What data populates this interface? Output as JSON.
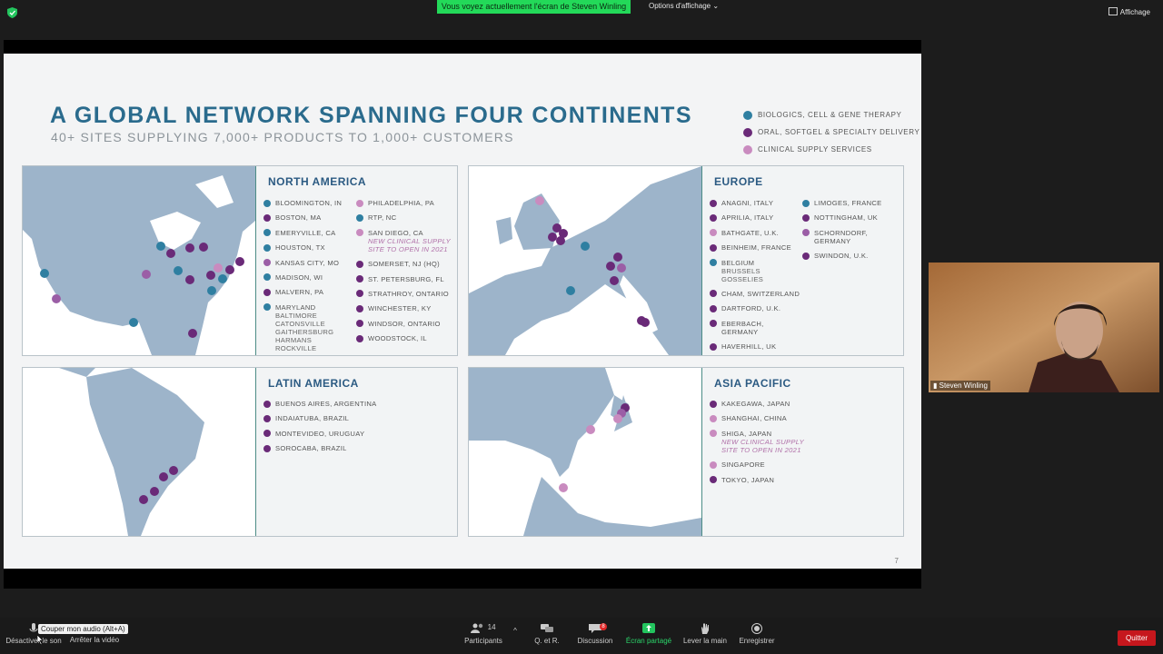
{
  "topbar": {
    "share_banner": "Vous voyez actuellement l'écran de Steven Winling",
    "view_options": "Options d'affichage ⌄",
    "view_label": "Affichage"
  },
  "slide": {
    "title": "A GLOBAL NETWORK SPANNING FOUR CONTINENTS",
    "subtitle": "40+ SITES SUPPLYING 7,000+ PRODUCTS TO 1,000+ CUSTOMERS",
    "legend": [
      {
        "label": "BIOLOGICS, CELL & GENE THERAPY",
        "color": "#2f7fa1"
      },
      {
        "label": "ORAL, SOFTGEL & SPECIALTY DELIVERY",
        "color": "#6a2a78"
      },
      {
        "label": "CLINICAL SUPPLY SERVICES",
        "color": "#c98bbf"
      }
    ],
    "page_number": "7",
    "regions": {
      "north_america": {
        "title": "NORTH AMERICA",
        "col1": [
          {
            "name": "BLOOMINGTON, IN",
            "color": "#2f7fa1"
          },
          {
            "name": "BOSTON, MA",
            "color": "#6a2a78"
          },
          {
            "name": "EMERYVILLE, CA",
            "color": "#2f7fa1"
          },
          {
            "name": "HOUSTON, TX",
            "color": "#2f7fa1"
          },
          {
            "name": "KANSAS CITY, MO",
            "color": "#9b5ea6"
          },
          {
            "name": "MADISON, WI",
            "color": "#2f7fa1"
          },
          {
            "name": "MALVERN, PA",
            "color": "#6a2a78"
          },
          {
            "name": "MARYLAND",
            "color": "#2f7fa1",
            "sub": "BALTIMORE\nCATONSVILLE\nGAITHERSBURG\nHARMANS\nROCKVILLE"
          }
        ],
        "col2": [
          {
            "name": "PHILADELPHIA, PA",
            "color": "#c98bbf"
          },
          {
            "name": "RTP, NC",
            "color": "#2f7fa1"
          },
          {
            "name": "SAN DIEGO, CA",
            "color": "#c98bbf",
            "note": "NEW CLINICAL SUPPLY\nSITE TO OPEN IN 2021"
          },
          {
            "name": "SOMERSET, NJ (HQ)",
            "color": "#6a2a78"
          },
          {
            "name": "ST. PETERSBURG, FL",
            "color": "#6a2a78"
          },
          {
            "name": "STRATHROY, ONTARIO",
            "color": "#6a2a78"
          },
          {
            "name": "WINCHESTER, KY",
            "color": "#6a2a78"
          },
          {
            "name": "WINDSOR, ONTARIO",
            "color": "#6a2a78"
          },
          {
            "name": "WOODSTOCK, IL",
            "color": "#6a2a78"
          }
        ]
      },
      "europe": {
        "title": "EUROPE",
        "col1": [
          {
            "name": "ANAGNI, ITALY",
            "color": "#6a2a78"
          },
          {
            "name": "APRILIA, ITALY",
            "color": "#6a2a78"
          },
          {
            "name": "BATHGATE, U.K.",
            "color": "#c98bbf"
          },
          {
            "name": "BEINHEIM, FRANCE",
            "color": "#6a2a78"
          },
          {
            "name": "BELGIUM",
            "color": "#2f7fa1",
            "sub": "BRUSSELS\nGOSSELIES"
          },
          {
            "name": "CHAM, SWITZERLAND",
            "color": "#6a2a78"
          },
          {
            "name": "DARTFORD, U.K.",
            "color": "#6a2a78"
          },
          {
            "name": "EBERBACH, GERMANY",
            "color": "#6a2a78"
          },
          {
            "name": "HAVERHILL, UK",
            "color": "#6a2a78"
          }
        ],
        "col2": [
          {
            "name": "LIMOGES, FRANCE",
            "color": "#2f7fa1"
          },
          {
            "name": "NOTTINGHAM, UK",
            "color": "#6a2a78"
          },
          {
            "name": "SCHORNDORF, GERMANY",
            "color": "#9b5ea6"
          },
          {
            "name": "SWINDON, U.K.",
            "color": "#6a2a78"
          }
        ]
      },
      "latin_america": {
        "title": "LATIN AMERICA",
        "col1": [
          {
            "name": "BUENOS AIRES, ARGENTINA",
            "color": "#6a2a78"
          },
          {
            "name": "INDAIATUBA, BRAZIL",
            "color": "#6a2a78"
          },
          {
            "name": "MONTEVIDEO, URUGUAY",
            "color": "#6a2a78"
          },
          {
            "name": "SOROCABA, BRAZIL",
            "color": "#6a2a78"
          }
        ]
      },
      "asia_pacific": {
        "title": "ASIA PACIFIC",
        "col1": [
          {
            "name": "KAKEGAWA, JAPAN",
            "color": "#6a2a78"
          },
          {
            "name": "SHANGHAI, CHINA",
            "color": "#c98bbf"
          },
          {
            "name": "SHIGA, JAPAN",
            "color": "#c98bbf",
            "note": "NEW CLINICAL SUPPLY\nSITE TO OPEN IN 2021"
          },
          {
            "name": "SINGAPORE",
            "color": "#c98bbf"
          },
          {
            "name": "TOKYO, JAPAN",
            "color": "#6a2a78"
          }
        ]
      }
    }
  },
  "video": {
    "participant_name": "Steven Winling"
  },
  "toolbar": {
    "mute_label": "Désactiver le son",
    "mute_tooltip": "Couper mon audio (Alt+A)",
    "video_label": "Arrêter la vidéo",
    "participants_label": "Participants",
    "participants_count": "14",
    "qa_label": "Q. et R.",
    "chat_label": "Discussion",
    "chat_badge": "8",
    "share_label": "Écran partagé",
    "raise_hand_label": "Lever la main",
    "record_label": "Enregistrer",
    "quit_label": "Quitter"
  }
}
